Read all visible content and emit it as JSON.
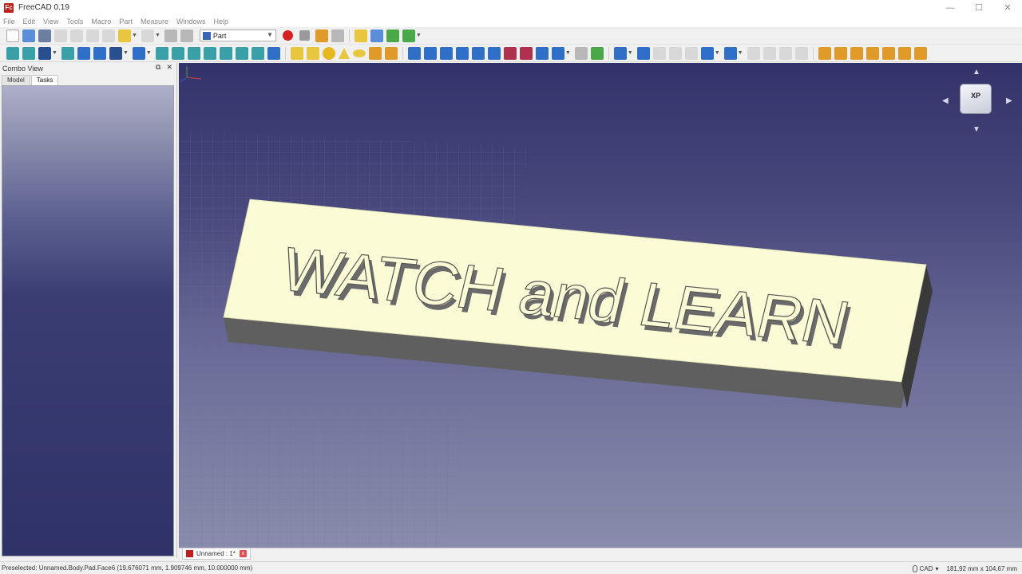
{
  "window": {
    "title": "FreeCAD 0.19",
    "logo_text": "Fc",
    "minimize": "—",
    "maximize": "☐",
    "close": "✕"
  },
  "menu": {
    "items": [
      "File",
      "Edit",
      "View",
      "Tools",
      "Macro",
      "Part",
      "Measure",
      "Windows",
      "Help"
    ]
  },
  "toolbar": {
    "workbench": "Part"
  },
  "combo_view": {
    "title": "Combo View",
    "tabs": [
      "Model",
      "Tasks"
    ],
    "active_tab": "Tasks"
  },
  "viewport": {
    "text3d": "WATCH and LEARN",
    "navcube_face": "XP",
    "colors": {
      "face_top": "#fbfbd6",
      "face_side": "#5f5f5f",
      "letter_shade": "#6a6a6a"
    }
  },
  "document_tab": {
    "label": "Unnamed : 1*",
    "close": "x"
  },
  "status": {
    "message": "Preselected: Unnamed.Body.Pad.Face6 (19.676071 mm, 1.909746 mm, 10.000000 mm)",
    "nav_style": "CAD",
    "dimensions": "181,92 mm x 104,67 mm"
  }
}
